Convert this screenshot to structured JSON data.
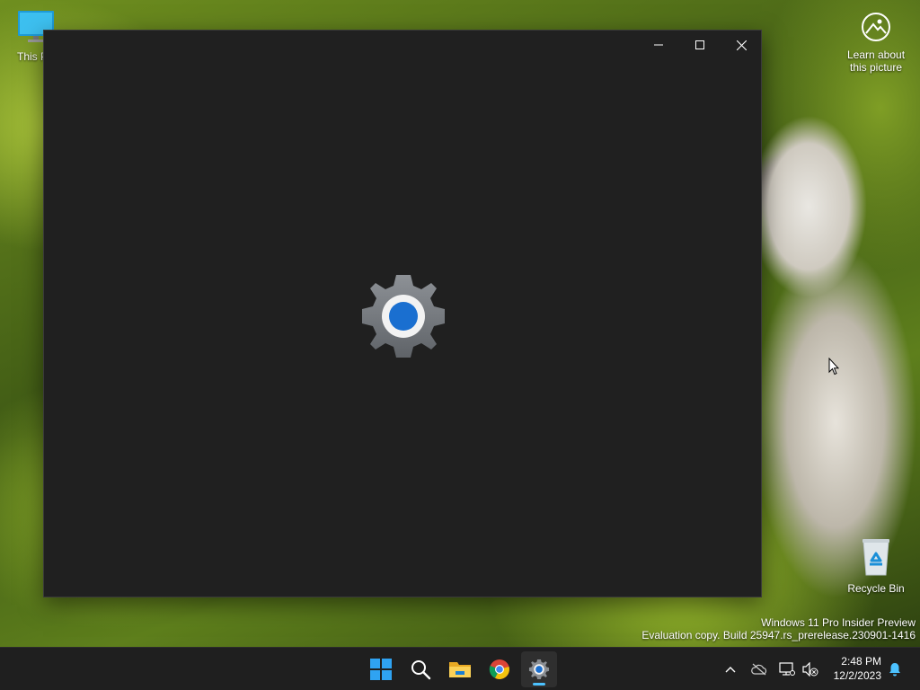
{
  "desktop": {
    "icons": [
      {
        "label": "This PC",
        "icon": "monitor-icon"
      },
      {
        "label": "Learn about\nthis picture",
        "icon": "learn-picture-icon"
      },
      {
        "label": "Recycle Bin",
        "icon": "recycle-bin-icon"
      }
    ],
    "this_pc_visible_label": "This P",
    "learn_line1": "Learn about",
    "learn_line2": "this picture",
    "recycle_label": "Recycle Bin"
  },
  "window": {
    "app_icon": "settings-gear-icon",
    "controls": [
      "minimize-icon",
      "maximize-icon",
      "close-icon"
    ]
  },
  "watermark": {
    "line1": "Windows 11 Pro Insider Preview",
    "line2": "Evaluation copy. Build 25947.rs_prerelease.230901-1416"
  },
  "taskbar": {
    "apps": [
      "start-icon",
      "search-icon",
      "file-explorer-icon",
      "chrome-icon",
      "settings-icon"
    ],
    "active_app": "settings-icon",
    "tray": [
      "chevron-up-icon",
      "onedrive-offline-icon",
      "network-icon",
      "volume-muted-icon"
    ],
    "time": "2:48 PM",
    "date": "12/2/2023",
    "notification_icon": "bell-icon"
  },
  "colors": {
    "accent": "#4cc2ff",
    "window_bg": "#202020",
    "taskbar_bg": "#1f1f1f"
  }
}
